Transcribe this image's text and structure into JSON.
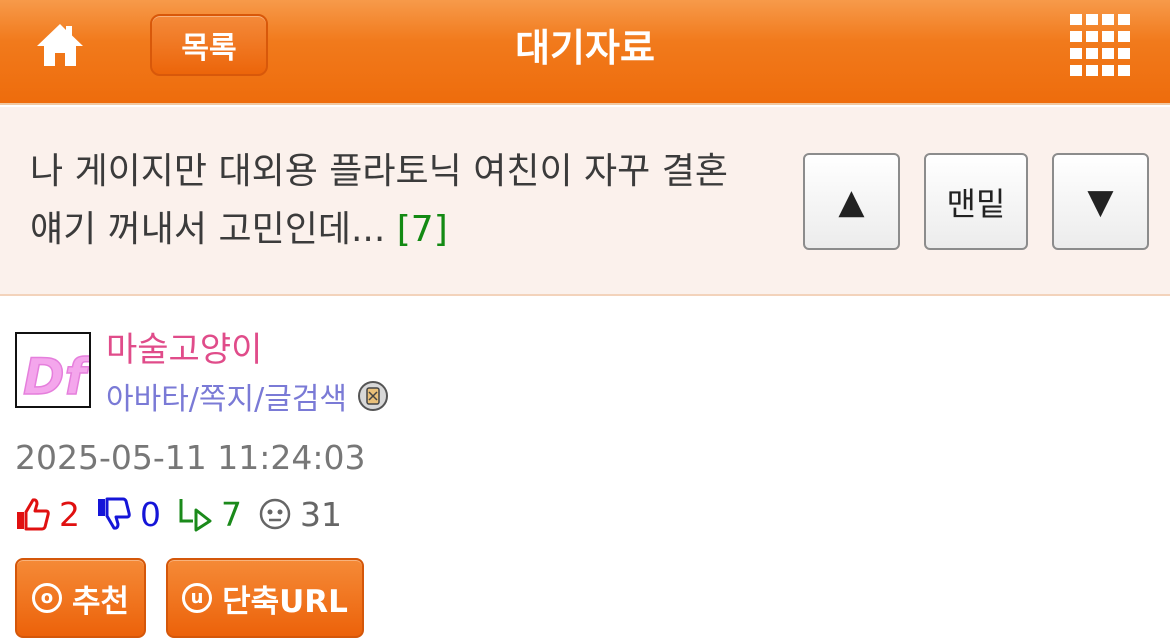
{
  "header": {
    "home_icon": "home-icon",
    "list_label": "목록",
    "title": "대기자료",
    "menu_icon": "grid-menu-icon",
    "accent_color": "#ee6c0c"
  },
  "post": {
    "title": "나 게이지만 대외용 플라토닉 여친이 자꾸 결혼 얘기 꺼내서 고민인데...",
    "comment_count": "[7]",
    "nav": {
      "up_label": "▲",
      "bottom_label": "맨밑",
      "down_label": "▼"
    }
  },
  "author": {
    "name": "마술고양이",
    "links": "아바타/쪽지/글검색",
    "avatar_text": "Df",
    "badge_icon": "badge-icon"
  },
  "meta": {
    "date": "2025-05-11 11:24:03"
  },
  "stats": {
    "upvotes": "2",
    "downvotes": "0",
    "replies": "7",
    "views": "31"
  },
  "actions": {
    "recommend_letter": "o",
    "recommend_label": "추천",
    "shorturl_letter": "u",
    "shorturl_label": "단축URL"
  }
}
